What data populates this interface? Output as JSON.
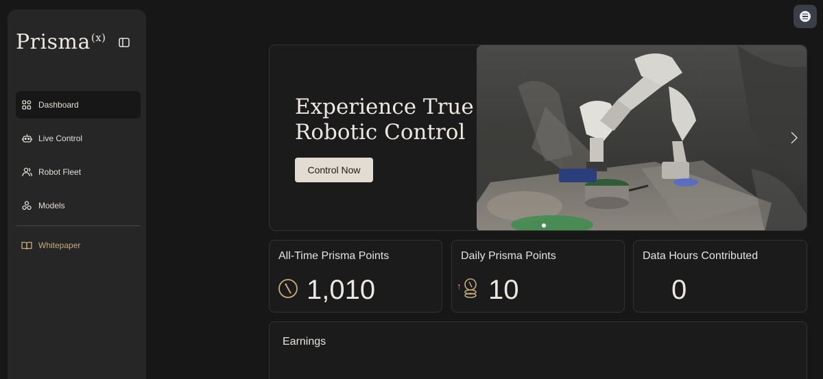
{
  "brand": {
    "name": "Prisma",
    "superscript": "(x)"
  },
  "sidebar": {
    "items": [
      {
        "label": "Dashboard",
        "icon": "dashboard-grid-icon",
        "active": true
      },
      {
        "label": "Live Control",
        "icon": "robot-icon"
      },
      {
        "label": "Robot Fleet",
        "icon": "users-icon"
      },
      {
        "label": "Models",
        "icon": "models-icon"
      }
    ],
    "secondary": [
      {
        "label": "Whitepaper",
        "icon": "book-icon"
      }
    ]
  },
  "hero": {
    "title": "Experience True Robotic Control",
    "cta_label": "Control Now",
    "slide_count": 1,
    "active_slide": 1
  },
  "stats": [
    {
      "title": "All-Time Prisma Points",
      "value": "1,010",
      "icon": "prisma-coin-icon"
    },
    {
      "title": "Daily Prisma Points",
      "value": "10",
      "icon": "coin-stack-up-icon",
      "prefix": "↑"
    },
    {
      "title": "Data Hours Contributed",
      "value": "0"
    }
  ],
  "earnings": {
    "title": "Earnings"
  },
  "colors": {
    "background": "#171717",
    "sidebar": "#262626",
    "card": "#1b1b1b",
    "accent_gold": "#c8ab7e",
    "button": "#e3dcd3"
  }
}
